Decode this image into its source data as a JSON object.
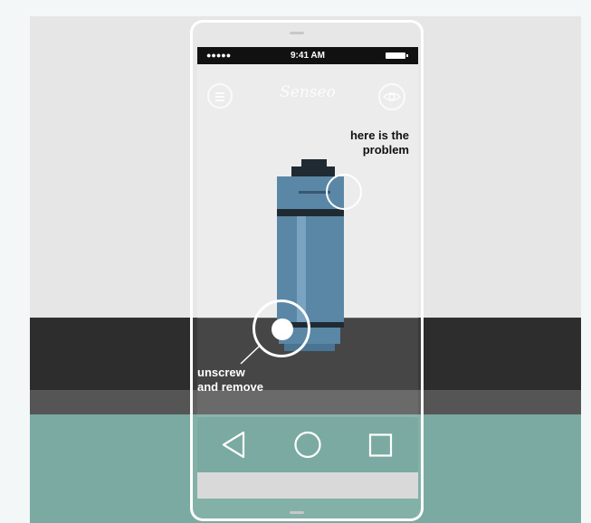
{
  "status_bar": {
    "signal": "●●●●●",
    "time": "9:41 AM"
  },
  "app": {
    "logo_text": "Senseo",
    "menu_icon": "hamburger-menu-icon",
    "eye_icon": "eye-icon"
  },
  "callouts": {
    "top_line1": "here is the",
    "top_line2": "problem",
    "bottom_line1": "unscrew",
    "bottom_line2": "and remove"
  },
  "navigation": {
    "back_icon": "back-triangle-icon",
    "home_icon": "home-circle-icon",
    "recents_icon": "recents-square-icon"
  },
  "colors": {
    "wall": "#e6e6e6",
    "counter": "#2d2d2d",
    "floor": "#7aaaa1",
    "machine_body": "#5b87a7",
    "machine_dark": "#1f2a33"
  }
}
